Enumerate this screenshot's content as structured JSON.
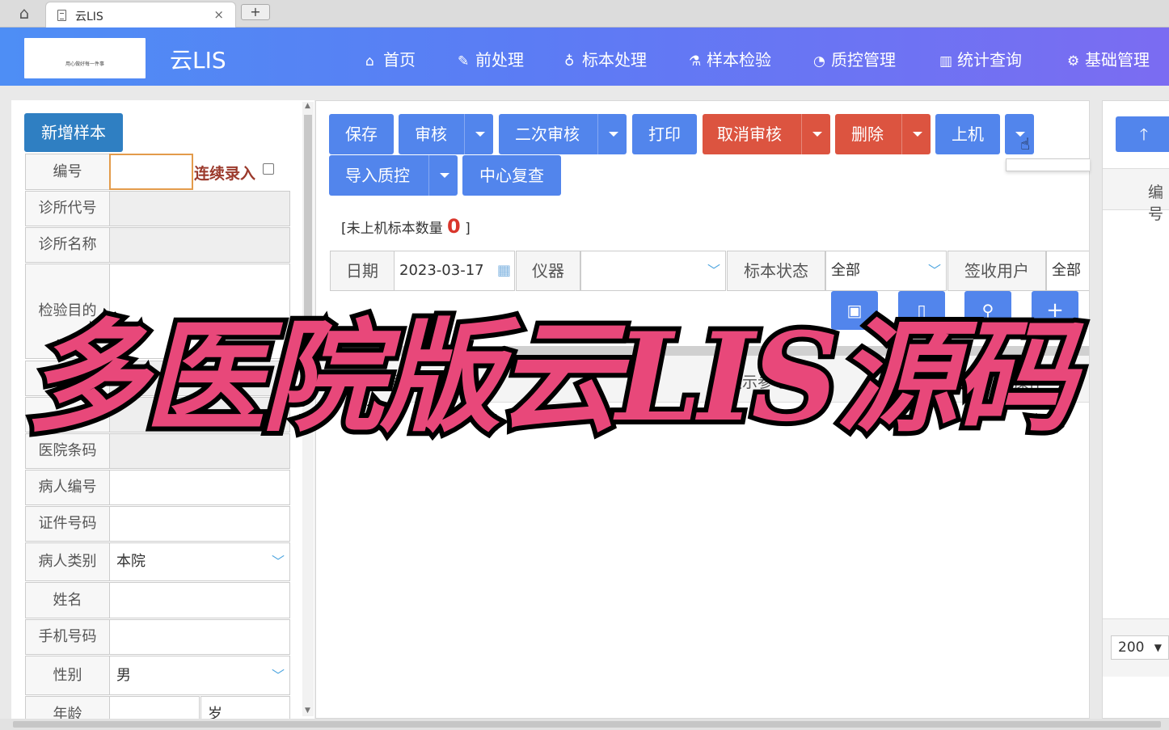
{
  "browser": {
    "tab_title": "云LIS",
    "close": "×",
    "newtab": "+"
  },
  "nav": {
    "brand": "云LIS",
    "logo_text": "用心做好每一件事",
    "items": [
      {
        "icon": "home-icon",
        "glyph": "⌂",
        "label": "首页"
      },
      {
        "icon": "wrench-icon",
        "glyph": "✎",
        "label": "前处理"
      },
      {
        "icon": "stethoscope-icon",
        "glyph": "♁",
        "label": "标本处理"
      },
      {
        "icon": "flask-icon",
        "glyph": "⚗",
        "label": "样本检验"
      },
      {
        "icon": "pie-chart-icon",
        "glyph": "◔",
        "label": "质控管理"
      },
      {
        "icon": "bar-chart-icon",
        "glyph": "▥",
        "label": "统计查询"
      },
      {
        "icon": "gear-icon",
        "glyph": "⚙",
        "label": "基础管理"
      }
    ]
  },
  "left": {
    "add_button": "新增样本",
    "continuous": "连续录入",
    "fields": [
      {
        "label": "编号",
        "value": ""
      },
      {
        "label": "诊所代号",
        "value": ""
      },
      {
        "label": "诊所名称",
        "value": ""
      },
      {
        "label": "检验目的",
        "value": ""
      },
      {
        "label": "",
        "value": ""
      },
      {
        "label": "",
        "value": ""
      },
      {
        "label": "医院条码",
        "value": ""
      },
      {
        "label": "病人编号",
        "value": ""
      },
      {
        "label": "证件号码",
        "value": ""
      },
      {
        "label": "病人类别",
        "value": "本院"
      },
      {
        "label": "姓名",
        "value": ""
      },
      {
        "label": "手机号码",
        "value": ""
      },
      {
        "label": "性别",
        "value": "男"
      },
      {
        "label": "年龄",
        "value": "",
        "unit": "岁"
      }
    ]
  },
  "toolbar": {
    "save": "保存",
    "audit": "审核",
    "second_audit": "二次审核",
    "print": "打印",
    "cancel_audit": "取消审核",
    "delete": "删除",
    "onboard": "上机",
    "import_qc": "导入质控",
    "center_review": "中心复查"
  },
  "status": {
    "prefix": "[未上机标本数量",
    "count": "0",
    "suffix": "]"
  },
  "filters": {
    "date_label": "日期",
    "date_value": "2023-03-17",
    "instrument_label": "仪器",
    "instrument_value": "",
    "status_label": "标本状态",
    "status_value": "全部",
    "user_label": "签收用户",
    "user_value": "全部"
  },
  "table": {
    "col1": "号",
    "col2": "提示参考",
    "col3": "操作"
  },
  "right": {
    "col": "编号",
    "page_size": "200"
  },
  "overlay": {
    "caption": "多医院版云LIS源码"
  }
}
